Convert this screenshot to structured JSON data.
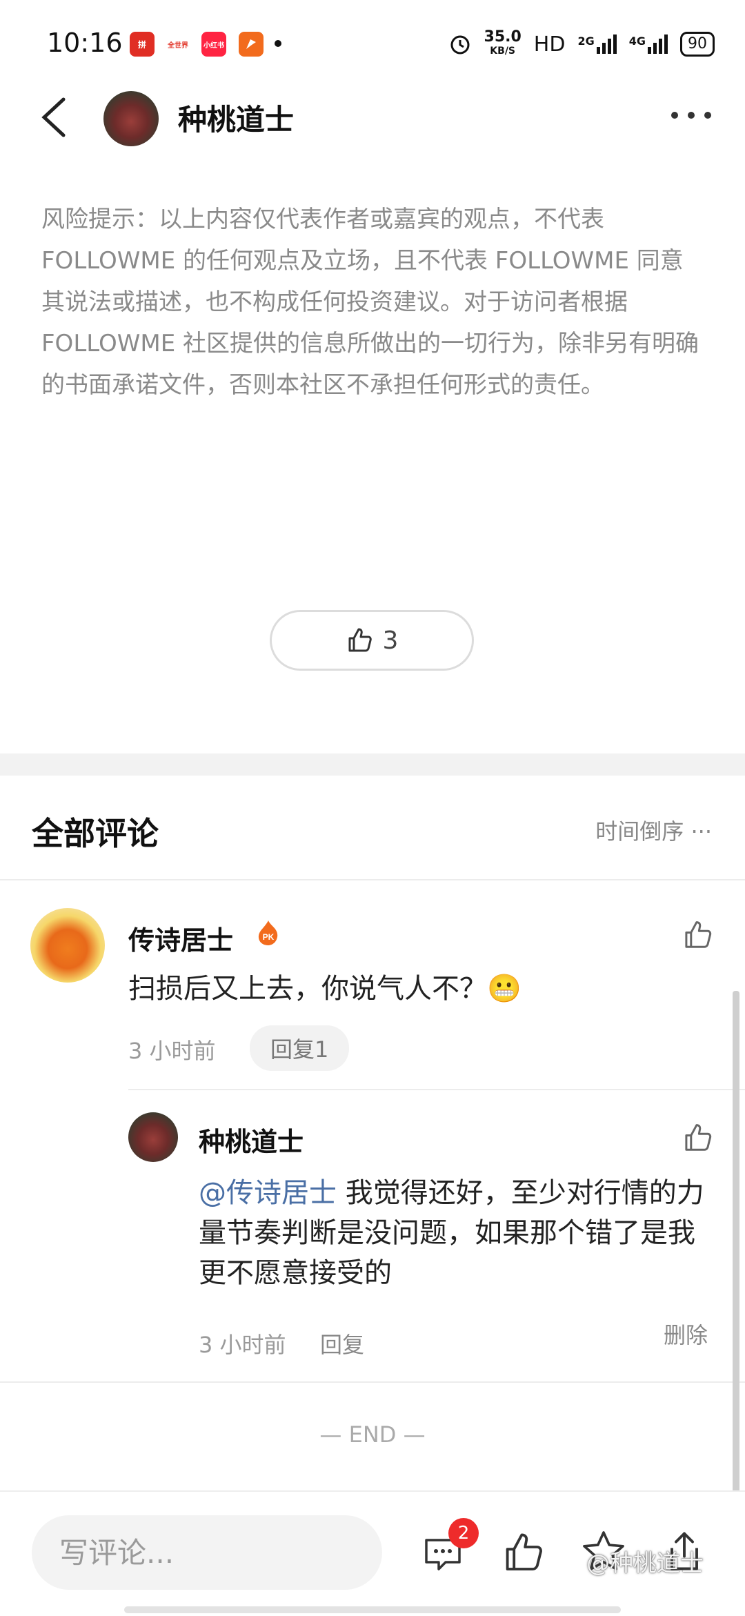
{
  "status_bar": {
    "time": "10:16",
    "apps": [
      {
        "icon": "pinduoduo-app-icon",
        "label": "拼",
        "color": "#e02e24"
      },
      {
        "icon": "quanshijie-app-icon",
        "label": "全世界",
        "color": "#e33c2f"
      },
      {
        "icon": "xiaohongshu-app-icon",
        "label": "小红书",
        "color": "#ff2442"
      },
      {
        "icon": "flag-app-icon",
        "label": "",
        "color": "#f26b1d"
      }
    ],
    "speed": "35.0",
    "speed_unit": "KB/S",
    "hd": "HD",
    "net1": "2G",
    "net2": "4G",
    "battery": "90"
  },
  "header": {
    "back_icon": "chevron-left-icon",
    "title": "种桃道士",
    "more_icon": "more-dots-icon"
  },
  "risk_notice": "风险提示：以上内容仅代表作者或嘉宾的观点，不代表 FOLLOWME 的任何观点及立场，且不代表 FOLLOWME 同意其说法或描述，也不构成任何投资建议。对于访问者根据 FOLLOWME 社区提供的信息所做出的一切行为，除非另有明确的书面承诺文件，否则本社区不承担任何形式的责任。",
  "like": {
    "icon": "thumbs-up-icon",
    "count": "3"
  },
  "comments_section": {
    "title": "全部评论",
    "sort_label": "时间倒序",
    "sort_icon": "ellipsis-icon"
  },
  "comments": [
    {
      "author": "传诗居士",
      "badge": "PK",
      "text": "扫损后又上去，你说气人不？😬",
      "time": "3 小时前",
      "reply_label": "回复1",
      "replies": [
        {
          "author": "种桃道士",
          "mention": "@传诗居士",
          "text": " 我觉得还好，至少对行情的力量节奏判断是没问题，如果那个错了是我更不愿意接受的",
          "time": "3 小时前",
          "reply_label": "回复",
          "delete_label": "删除"
        }
      ]
    }
  ],
  "end_label": "— END —",
  "bottom_bar": {
    "input_placeholder": "写评论...",
    "comment_badge": "2",
    "watermark": "@种桃道士"
  },
  "colors": {
    "accent_red": "#ee2b2b",
    "mention_blue": "#4a6fa5",
    "muted_gray": "#8a8a8a"
  }
}
